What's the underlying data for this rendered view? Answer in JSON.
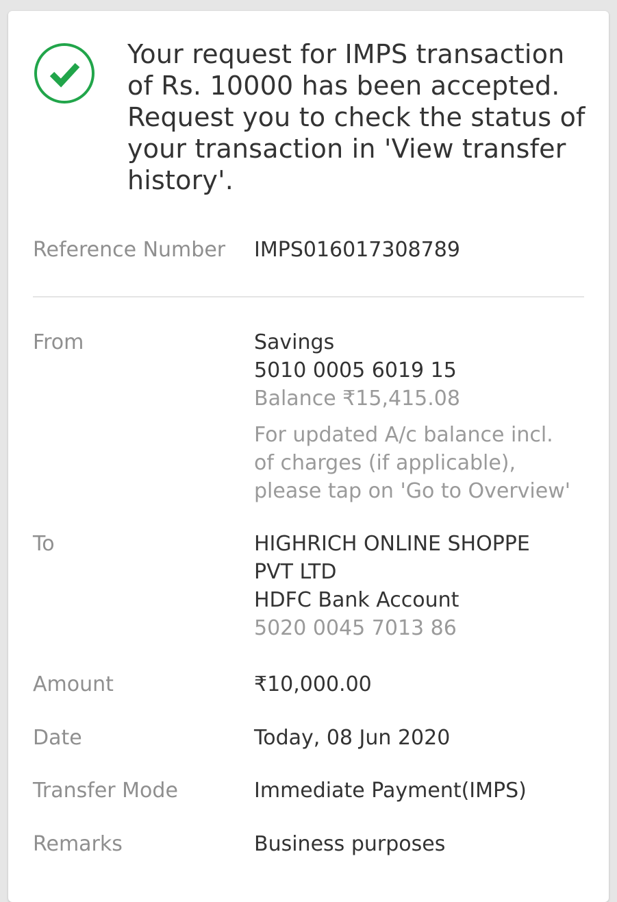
{
  "confirmation": {
    "status_icon": "check-circle-icon",
    "accent_color": "#21a54a",
    "message_lines": [
      "Your request for IMPS transaction",
      "of Rs. 10000 has been accepted.",
      "Request you to check the status of",
      "your transaction in 'View transfer",
      "history'."
    ]
  },
  "details": {
    "reference": {
      "label": "Reference Number",
      "value": "IMPS016017308789"
    },
    "from": {
      "label": "From",
      "account_type": "Savings",
      "account_number": "5010 0005 6019 15",
      "balance": "Balance ₹15,415.08",
      "note_lines": [
        "For updated A/c balance incl.",
        "of charges (if applicable),",
        "please tap on 'Go to Overview'"
      ]
    },
    "to": {
      "label": "To",
      "payee_lines": [
        "HIGHRICH ONLINE SHOPPE",
        "PVT LTD"
      ],
      "bank": "HDFC Bank Account",
      "account_number": "5020 0045 7013 86"
    },
    "amount": {
      "label": "Amount",
      "value": "₹10,000.00"
    },
    "date": {
      "label": "Date",
      "value": "Today, 08 Jun 2020"
    },
    "transfer_mode": {
      "label": "Transfer Mode",
      "value": "Immediate Payment(IMPS)"
    },
    "remarks": {
      "label": "Remarks",
      "value": "Business purposes"
    }
  }
}
